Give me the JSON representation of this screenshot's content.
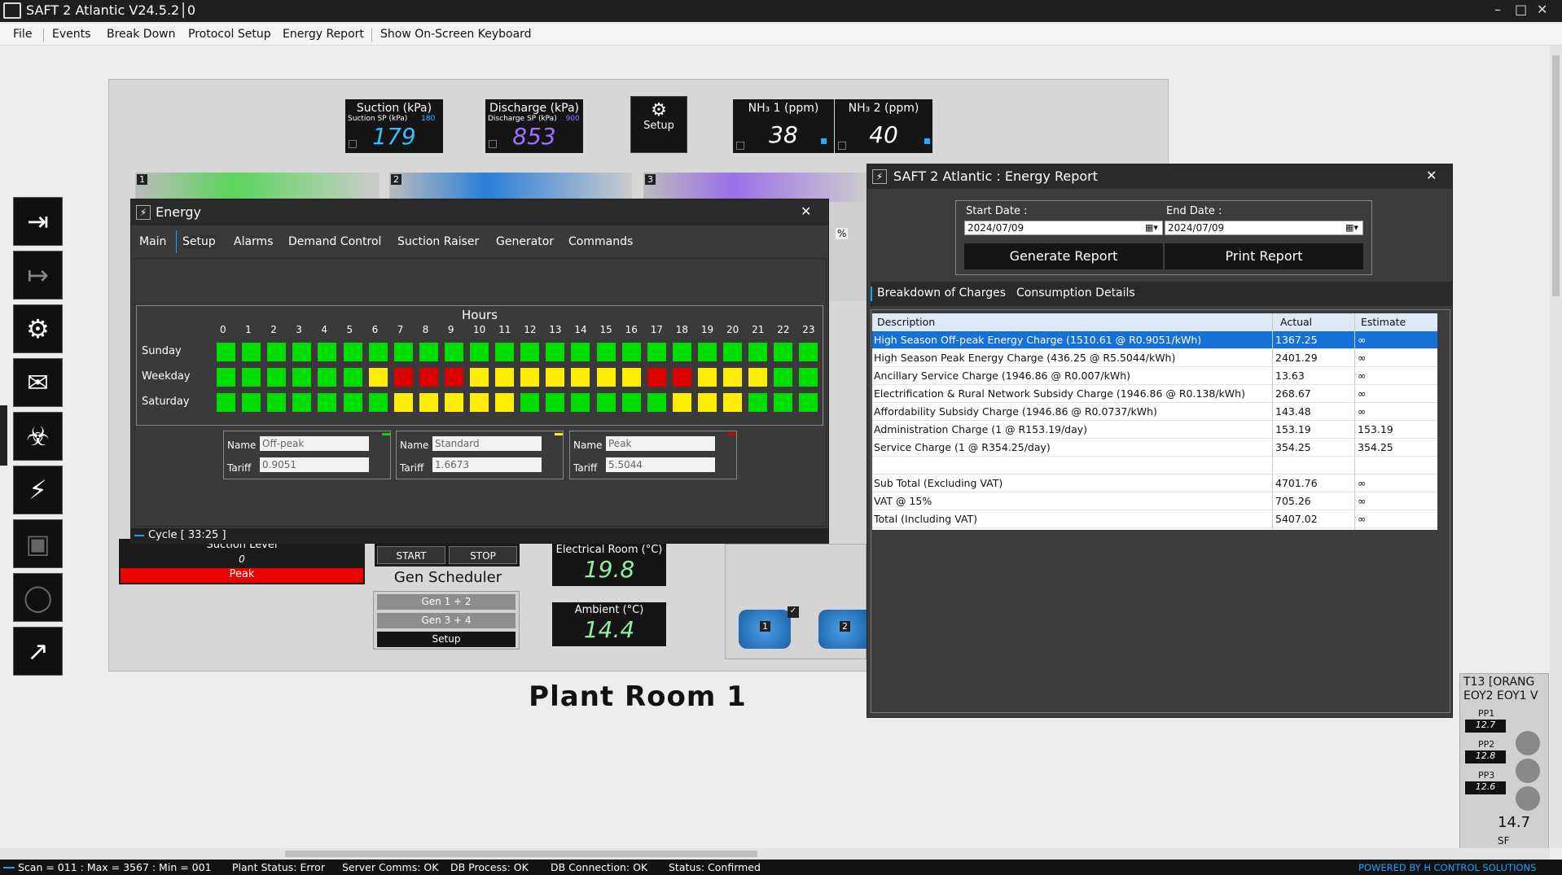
{
  "app": {
    "title": "SAFT 2 Atlantic V24.5.2│0"
  },
  "menu": [
    "File",
    "Events",
    "Break Down",
    "Protocol Setup",
    "Energy Report",
    "Show On-Screen Keyboard"
  ],
  "gauges": {
    "suction": {
      "title": "Suction (kPa)",
      "sp_label": "Suction SP (kPa)",
      "sp": "180",
      "value": "179",
      "color": "#33c0ff"
    },
    "discharge": {
      "title": "Discharge (kPa)",
      "sp_label": "Discharge SP (kPa)",
      "sp": "900",
      "value": "853",
      "color": "#a070ff"
    },
    "setup": "Setup",
    "nh3_1": {
      "title": "NH₃ 1 (ppm)",
      "value": "38"
    },
    "nh3_2": {
      "title": "NH₃ 2 (ppm)",
      "value": "40"
    }
  },
  "plant": {
    "title": "Plant Room 1",
    "compressor_numbers": [
      "1",
      "2",
      "3"
    ],
    "cycle": "Cycle [ 33:25 ]",
    "suction_level": {
      "title": "Suction Level",
      "value": "0",
      "status": "Peak",
      "status_color": "#ee0000"
    },
    "gen": {
      "start": "START",
      "stop": "STOP",
      "title": "Gen Scheduler",
      "items": [
        "Gen 1 + 2",
        "Gen 3 + 4",
        "Setup"
      ]
    },
    "electrical_room": {
      "title": "Electrical Room (°C)",
      "value": "19.8"
    },
    "ambient": {
      "title": "Ambient (°C)",
      "value": "14.4"
    },
    "pump_labels": [
      "1",
      "2"
    ],
    "right_panel": {
      "title": "T13 [ORANG",
      "sub": "EOY2 EOY1 V",
      "pp": [
        {
          "label": "PP1",
          "value": "12.7"
        },
        {
          "label": "PP2",
          "value": "12.8"
        },
        {
          "label": "PP3",
          "value": "12.6"
        }
      ],
      "bottom": "14.7",
      "bottom2": "SF"
    },
    "percent": "%"
  },
  "energy": {
    "title": "Energy",
    "tabs": [
      "Main",
      "Setup",
      "Alarms",
      "Demand Control",
      "Suction Raiser",
      "Generator",
      "Commands"
    ],
    "hours_title": "Hours",
    "hours": [
      "0",
      "1",
      "2",
      "3",
      "4",
      "5",
      "6",
      "7",
      "8",
      "9",
      "10",
      "11",
      "12",
      "13",
      "14",
      "15",
      "16",
      "17",
      "18",
      "19",
      "20",
      "21",
      "22",
      "23"
    ],
    "rows": [
      {
        "label": "Sunday",
        "cells": "gggggggggggggggggggggggg"
      },
      {
        "label": "Weekday",
        "cells": "ggggggyrrryyyyyyyrryyygg"
      },
      {
        "label": "Saturday",
        "cells": "gggggggyyyyyggggggyyyggg"
      }
    ],
    "tariffs": [
      {
        "name_label": "Name",
        "tariff_label": "Tariff",
        "name": "Off-peak",
        "tariff": "0.9051",
        "color": "#00dd00"
      },
      {
        "name_label": "Name",
        "tariff_label": "Tariff",
        "name": "Standard",
        "tariff": "1.6673",
        "color": "#ffee00"
      },
      {
        "name_label": "Name",
        "tariff_label": "Tariff",
        "name": "Peak",
        "tariff": "5.5044",
        "color": "#dd0000"
      }
    ]
  },
  "report": {
    "title": "SAFT 2 Atlantic : Energy Report",
    "start_label": "Start Date :",
    "start_date": "2024/07/09",
    "end_label": "End Date :",
    "end_date": "2024/07/09",
    "generate": "Generate Report",
    "print": "Print Report",
    "tabs": [
      "Breakdown of Charges",
      "Consumption Details"
    ],
    "columns": [
      "Description",
      "Actual",
      "Estimate"
    ],
    "rows": [
      [
        "High Season Off-peak Energy Charge (1510.61 @ R0.9051/kWh)",
        "1367.25",
        "∞"
      ],
      [
        "High Season Peak Energy Charge (436.25 @ R5.5044/kWh)",
        "2401.29",
        "∞"
      ],
      [
        "Ancillary Service Charge (1946.86 @ R0.007/kWh)",
        "13.63",
        "∞"
      ],
      [
        "Electrification & Rural Network Subsidy Charge (1946.86 @ R0.138/kWh)",
        "268.67",
        "∞"
      ],
      [
        "Affordability Subsidy Charge (1946.86 @ R0.0737/kWh)",
        "143.48",
        "∞"
      ],
      [
        "Administration Charge (1 @ R153.19/day)",
        "153.19",
        "153.19"
      ],
      [
        "Service Charge (1 @ R354.25/day)",
        "354.25",
        "354.25"
      ],
      [
        "",
        "",
        ""
      ],
      [
        "Sub Total (Excluding VAT)",
        "4701.76",
        "∞"
      ],
      [
        "VAT @ 15%",
        "705.26",
        "∞"
      ],
      [
        "Total (Including VAT)",
        "5407.02",
        "∞"
      ]
    ]
  },
  "status": {
    "scan": "Scan = 011 : Max = 3567 : Min = 001",
    "plant": "Plant Status: Error",
    "server": "Server Comms: OK",
    "dbp": "DB Process:  OK",
    "dbc": "DB Connection:  OK",
    "st": "Status:  Confirmed",
    "powered": "POWERED BY H CONTROL SOLUTIONS"
  }
}
